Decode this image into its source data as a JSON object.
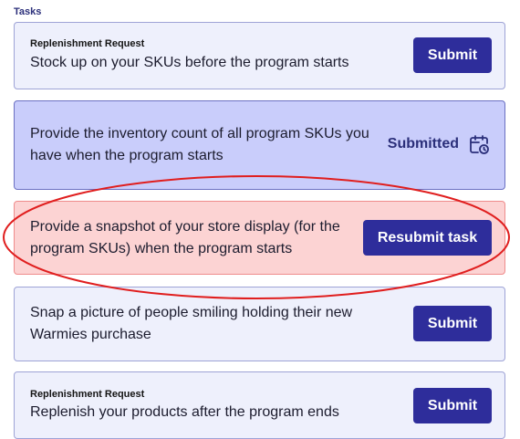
{
  "section_title": "Tasks",
  "tasks": [
    {
      "eyebrow": "Replenishment Request",
      "description": "Stock up on your SKUs before the program starts",
      "button_label": "Submit"
    },
    {
      "description_line1": "Provide the inventory count of all program SKUs you",
      "description_line2": "have when the program starts",
      "status_label": "Submitted",
      "status_icon": "calendar-clock-icon"
    },
    {
      "description_line1": "Provide a snapshot of your store display (for the",
      "description_line2": "program SKUs) when the program starts",
      "button_label": "Resubmit task"
    },
    {
      "description_line1": "Snap a picture of people smiling holding their new",
      "description_line2": "Warmies purchase",
      "button_label": "Submit"
    },
    {
      "eyebrow": "Replenishment Request",
      "description": "Replenish your products after the program ends",
      "button_label": "Submit"
    }
  ],
  "colors": {
    "primary_button": "#2e2d9b",
    "card_default": "#eef0fc",
    "card_submitted": "#c9cdfb",
    "card_rejected": "#fcd3d3",
    "annotation": "#e01e1e"
  }
}
